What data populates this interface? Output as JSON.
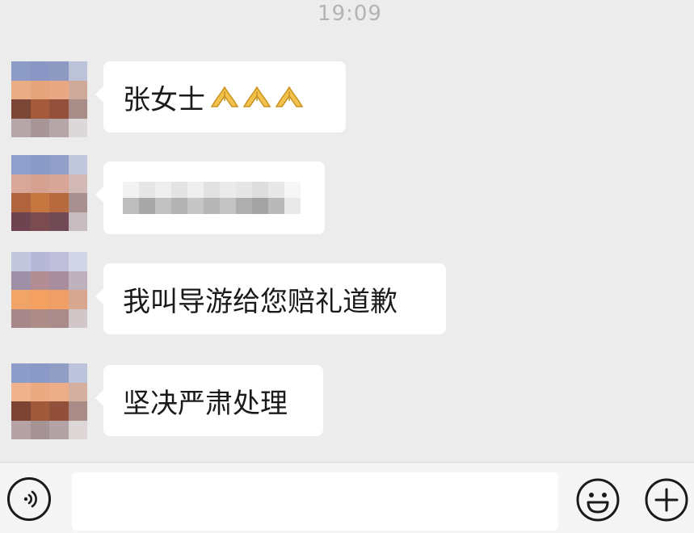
{
  "status": {
    "time": "19:09"
  },
  "messages": [
    {
      "text": "张女士",
      "emojis": [
        "folded-hands",
        "folded-hands",
        "folded-hands"
      ]
    },
    {
      "text": "",
      "blurred": true
    },
    {
      "text": "我叫导游给您赔礼道歉"
    },
    {
      "text": "坚决严肃处理"
    }
  ],
  "input_bar": {
    "placeholder": "",
    "icons": [
      "voice-icon",
      "emoji-icon",
      "plus-icon"
    ]
  },
  "colors": {
    "chat_background": "#ececec",
    "bubble": "#ffffff",
    "timestamp": "#b3b3b3",
    "icon_stroke": "#1a1a1a"
  }
}
